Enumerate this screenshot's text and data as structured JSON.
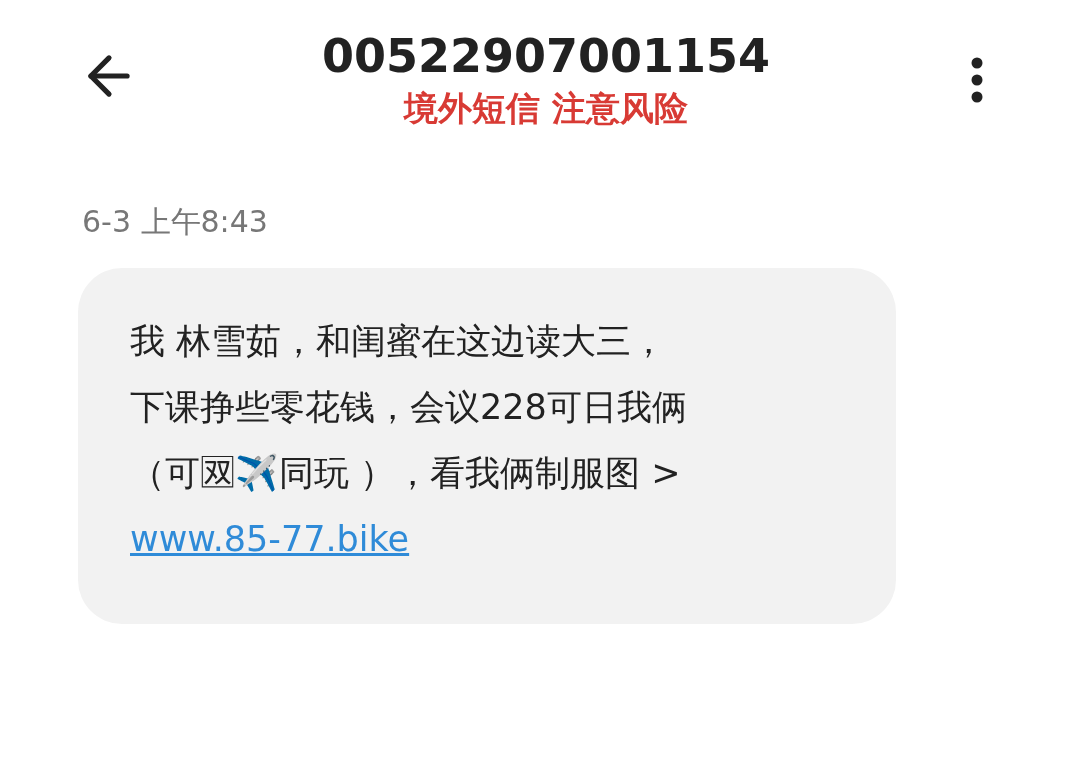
{
  "header": {
    "title": "00522907001154",
    "warning": "境外短信 注意风险"
  },
  "timestamp": "6-3 上午8:43",
  "message": {
    "lines": [
      "我 林雪茹，和闺蜜在这边读大三，",
      "下课挣些零花钱，会议228可日我俩",
      "（可🈒✈️同玩 ），看我俩制服图 >"
    ],
    "link": "www.85-77.bike"
  }
}
